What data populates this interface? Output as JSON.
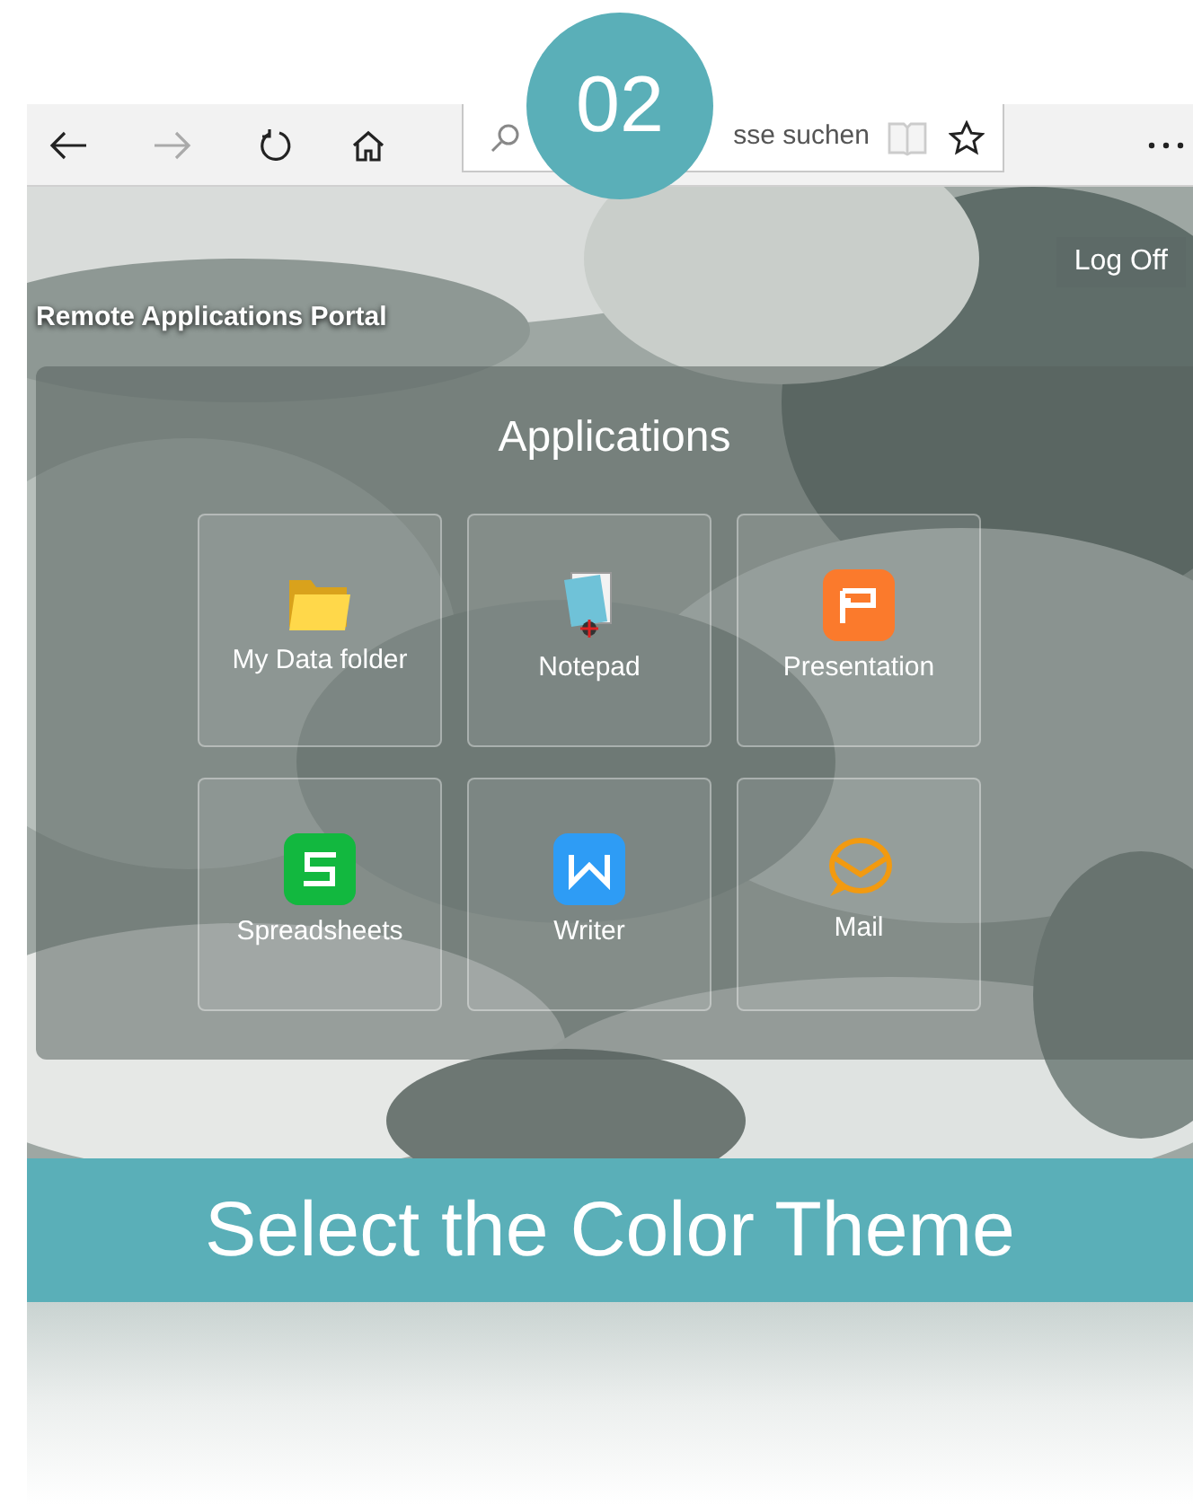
{
  "step_badge": "02",
  "browser": {
    "address_placeholder": "sse suchen"
  },
  "portal": {
    "title": "Remote Applications Portal",
    "log_off": "Log Off"
  },
  "applications": {
    "heading": "Applications",
    "tiles": [
      {
        "label": "My Data folder",
        "kind": "folder"
      },
      {
        "label": "Notepad",
        "kind": "notepad"
      },
      {
        "label": "Presentation",
        "kind": "presentation"
      },
      {
        "label": "Spreadsheets",
        "kind": "spreadsheet"
      },
      {
        "label": "Writer",
        "kind": "writer"
      },
      {
        "label": "Mail",
        "kind": "mail"
      }
    ]
  },
  "banner": "Select the Color Theme"
}
